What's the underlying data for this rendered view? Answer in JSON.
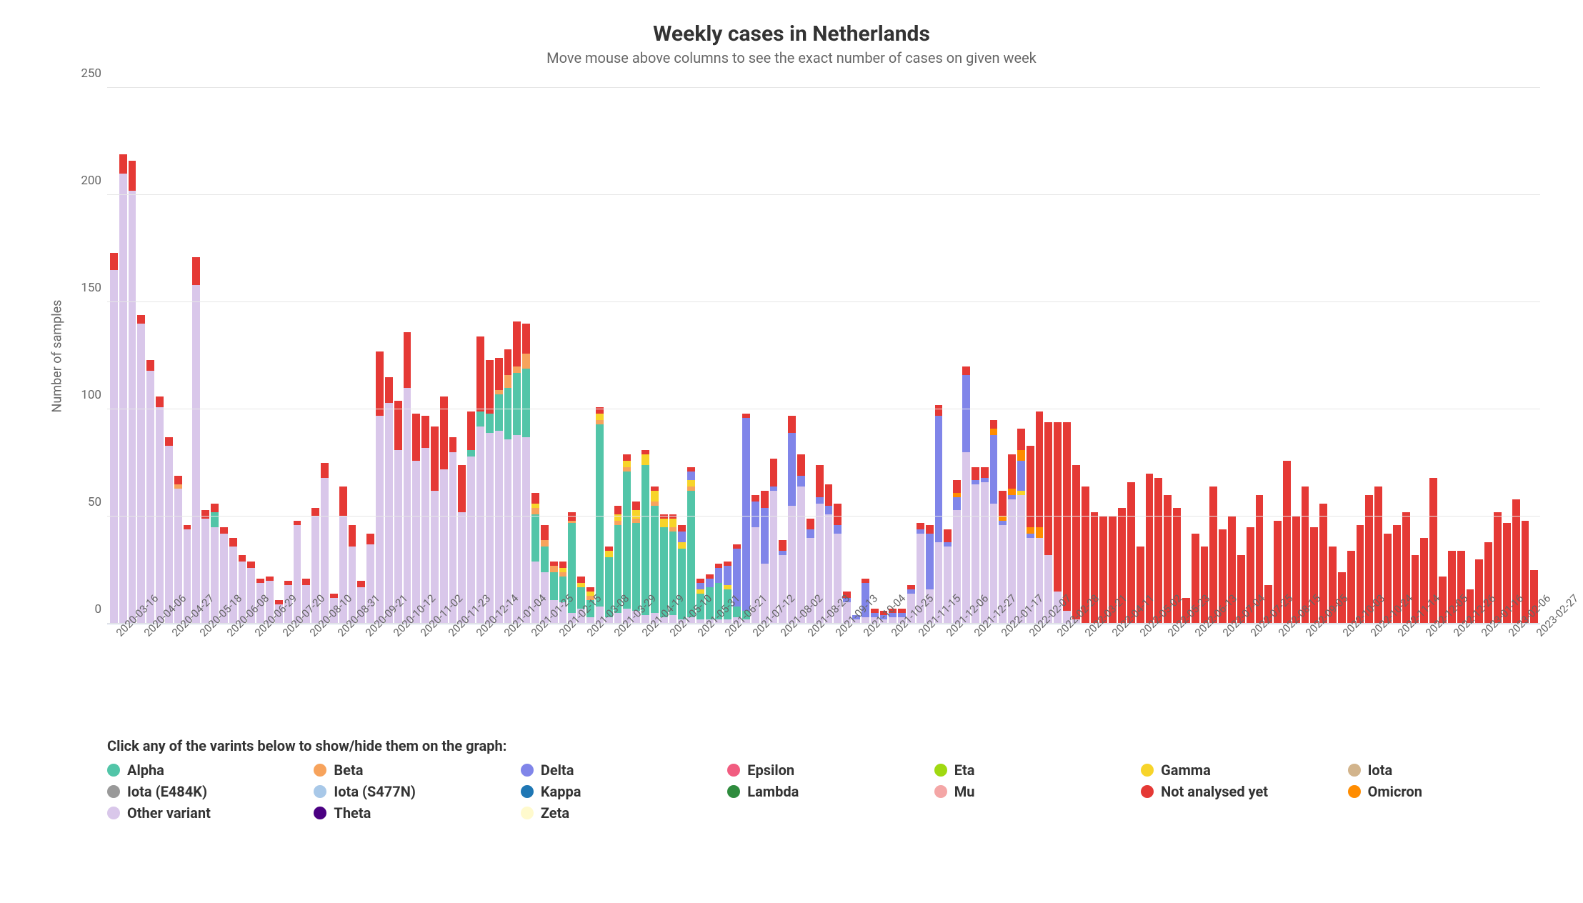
{
  "title": "Weekly cases in Netherlands",
  "subtitle": "Move mouse above columns to see the exact number of cases on given week",
  "ylabel": "Number of samples",
  "legend_title": "Click any of the varints below to show/hide them on the graph:",
  "series": [
    {
      "key": "alpha",
      "name": "Alpha",
      "color": "#52c5a8"
    },
    {
      "key": "beta",
      "name": "Beta",
      "color": "#f7a35c"
    },
    {
      "key": "delta",
      "name": "Delta",
      "color": "#8085e9"
    },
    {
      "key": "epsilon",
      "name": "Epsilon",
      "color": "#f15c80"
    },
    {
      "key": "eta",
      "name": "Eta",
      "color": "#a0d911"
    },
    {
      "key": "gamma",
      "name": "Gamma",
      "color": "#f7d42a"
    },
    {
      "key": "iota",
      "name": "Iota",
      "color": "#d2b48c"
    },
    {
      "key": "iota_e484k",
      "name": "Iota (E484K)",
      "color": "#999999"
    },
    {
      "key": "iota_s477n",
      "name": "Iota (S477N)",
      "color": "#a8c8e8"
    },
    {
      "key": "kappa",
      "name": "Kappa",
      "color": "#1f77b4"
    },
    {
      "key": "lambda",
      "name": "Lambda",
      "color": "#2e8b3d"
    },
    {
      "key": "mu",
      "name": "Mu",
      "color": "#f4a6a6"
    },
    {
      "key": "not_analysed",
      "name": "Not analysed yet",
      "color": "#e53935"
    },
    {
      "key": "omicron",
      "name": "Omicron",
      "color": "#ff8c00"
    },
    {
      "key": "other",
      "name": "Other variant",
      "color": "#d9c7ea"
    },
    {
      "key": "theta",
      "name": "Theta",
      "color": "#4b0082"
    },
    {
      "key": "zeta",
      "name": "Zeta",
      "color": "#fffacd"
    }
  ],
  "chart_data": {
    "type": "bar",
    "title": "Weekly cases in Netherlands",
    "xlabel": "",
    "ylabel": "Number of samples",
    "ylim": [
      0,
      250
    ],
    "yticks": [
      0,
      50,
      100,
      150,
      200,
      250
    ],
    "categories": [
      "2020-03-16",
      "2020-03-23",
      "2020-03-30",
      "2020-04-06",
      "2020-04-13",
      "2020-04-20",
      "2020-04-27",
      "2020-05-04",
      "2020-05-11",
      "2020-05-18",
      "2020-05-25",
      "2020-06-01",
      "2020-06-08",
      "2020-06-15",
      "2020-06-22",
      "2020-06-29",
      "2020-07-06",
      "2020-07-13",
      "2020-07-20",
      "2020-07-27",
      "2020-08-03",
      "2020-08-10",
      "2020-08-17",
      "2020-08-24",
      "2020-08-31",
      "2020-09-07",
      "2020-09-14",
      "2020-09-21",
      "2020-09-28",
      "2020-10-05",
      "2020-10-12",
      "2020-10-19",
      "2020-10-26",
      "2020-11-02",
      "2020-11-09",
      "2020-11-16",
      "2020-11-23",
      "2020-11-30",
      "2020-12-07",
      "2020-12-14",
      "2020-12-21",
      "2020-12-28",
      "2021-01-04",
      "2021-01-11",
      "2021-01-18",
      "2021-01-25",
      "2021-02-01",
      "2021-02-08",
      "2021-02-15",
      "2021-02-22",
      "2021-03-01",
      "2021-03-08",
      "2021-03-15",
      "2021-03-22",
      "2021-03-29",
      "2021-04-05",
      "2021-04-12",
      "2021-04-19",
      "2021-04-26",
      "2021-05-03",
      "2021-05-10",
      "2021-05-17",
      "2021-05-24",
      "2021-05-31",
      "2021-06-07",
      "2021-06-14",
      "2021-06-21",
      "2021-06-28",
      "2021-07-05",
      "2021-07-12",
      "2021-07-19",
      "2021-07-26",
      "2021-08-02",
      "2021-08-09",
      "2021-08-16",
      "2021-08-23",
      "2021-08-30",
      "2021-09-06",
      "2021-09-13",
      "2021-09-20",
      "2021-09-27",
      "2021-10-04",
      "2021-10-11",
      "2021-10-18",
      "2021-10-25",
      "2021-11-01",
      "2021-11-08",
      "2021-11-15",
      "2021-11-22",
      "2021-11-29",
      "2021-12-06",
      "2021-12-13",
      "2021-12-20",
      "2021-12-27",
      "2022-01-03",
      "2022-01-10",
      "2022-01-17",
      "2022-01-24",
      "2022-01-31",
      "2022-02-07",
      "2022-02-14",
      "2022-02-21",
      "2022-02-28",
      "2022-03-07",
      "2022-03-14",
      "2022-03-21",
      "2022-03-28",
      "2022-04-04",
      "2022-04-11",
      "2022-04-18",
      "2022-04-25",
      "2022-05-02",
      "2022-05-09",
      "2022-05-16",
      "2022-05-23",
      "2022-05-30",
      "2022-06-06",
      "2022-06-13",
      "2022-06-20",
      "2022-06-27",
      "2022-07-04",
      "2022-07-11",
      "2022-07-18",
      "2022-07-25",
      "2022-08-01",
      "2022-08-08",
      "2022-08-15",
      "2022-08-22",
      "2022-08-29",
      "2022-09-05",
      "2022-09-12",
      "2022-09-19",
      "2022-09-26",
      "2022-10-03",
      "2022-10-10",
      "2022-10-17",
      "2022-10-24",
      "2022-10-31",
      "2022-11-07",
      "2022-11-14",
      "2022-11-21",
      "2022-11-28",
      "2022-12-05",
      "2022-12-12",
      "2022-12-19",
      "2022-12-26",
      "2023-01-02",
      "2023-01-09",
      "2023-01-16",
      "2023-01-23",
      "2023-01-30",
      "2023-02-06",
      "2023-02-13",
      "2023-02-20",
      "2023-02-27"
    ],
    "xticks_visible": [
      "2020-03-16",
      "2020-04-06",
      "2020-04-27",
      "2020-05-18",
      "2020-06-08",
      "2020-06-29",
      "2020-07-20",
      "2020-08-10",
      "2020-08-31",
      "2020-09-21",
      "2020-10-12",
      "2020-11-02",
      "2020-11-23",
      "2020-12-14",
      "2021-01-04",
      "2021-01-25",
      "2021-02-15",
      "2021-03-08",
      "2021-03-29",
      "2021-04-19",
      "2021-05-10",
      "2021-05-31",
      "2021-06-21",
      "2021-07-12",
      "2021-08-02",
      "2021-08-23",
      "2021-09-13",
      "2021-10-04",
      "2021-10-25",
      "2021-11-15",
      "2021-12-06",
      "2021-12-27",
      "2022-01-17",
      "2022-02-07",
      "2022-02-28",
      "2022-03-21",
      "2022-04-11",
      "2022-05-02",
      "2022-05-23",
      "2022-06-13",
      "2022-07-04",
      "2022-07-25",
      "2022-08-15",
      "2022-09-05",
      "2022-10-03",
      "2022-10-24",
      "2022-11-14",
      "2022-12-05",
      "2022-12-26",
      "2023-01-16",
      "2023-02-06",
      "2023-02-27"
    ],
    "stacks": [
      {
        "other": 165,
        "not_analysed": 8
      },
      {
        "other": 210,
        "not_analysed": 9
      },
      {
        "other": 202,
        "not_analysed": 14
      },
      {
        "other": 140,
        "not_analysed": 4
      },
      {
        "other": 118,
        "not_analysed": 5
      },
      {
        "other": 101,
        "not_analysed": 5
      },
      {
        "other": 83,
        "not_analysed": 4
      },
      {
        "other": 63,
        "not_analysed": 4,
        "beta": 2
      },
      {
        "other": 44,
        "not_analysed": 2
      },
      {
        "other": 158,
        "not_analysed": 13
      },
      {
        "other": 49,
        "not_analysed": 4
      },
      {
        "other": 45,
        "not_analysed": 4,
        "alpha": 7
      },
      {
        "other": 42,
        "not_analysed": 3
      },
      {
        "other": 36,
        "not_analysed": 4
      },
      {
        "other": 29,
        "not_analysed": 3
      },
      {
        "other": 26,
        "not_analysed": 3
      },
      {
        "other": 19,
        "not_analysed": 2
      },
      {
        "other": 20,
        "not_analysed": 2
      },
      {
        "other": 9,
        "not_analysed": 2
      },
      {
        "other": 18,
        "not_analysed": 2
      },
      {
        "other": 46,
        "not_analysed": 2
      },
      {
        "other": 18,
        "not_analysed": 3
      },
      {
        "other": 50,
        "not_analysed": 4
      },
      {
        "other": 68,
        "not_analysed": 7
      },
      {
        "other": 12,
        "not_analysed": 2
      },
      {
        "other": 50,
        "not_analysed": 14
      },
      {
        "other": 36,
        "not_analysed": 10
      },
      {
        "other": 17,
        "not_analysed": 3
      },
      {
        "other": 37,
        "not_analysed": 5
      },
      {
        "other": 97,
        "not_analysed": 30
      },
      {
        "other": 103,
        "not_analysed": 12
      },
      {
        "other": 81,
        "not_analysed": 23
      },
      {
        "other": 110,
        "not_analysed": 26
      },
      {
        "other": 76,
        "not_analysed": 22
      },
      {
        "other": 82,
        "not_analysed": 15
      },
      {
        "other": 62,
        "not_analysed": 30
      },
      {
        "other": 72,
        "not_analysed": 34
      },
      {
        "other": 80,
        "not_analysed": 7
      },
      {
        "other": 52,
        "not_analysed": 22
      },
      {
        "other": 78,
        "not_analysed": 18,
        "alpha": 3
      },
      {
        "other": 92,
        "not_analysed": 35,
        "alpha": 7
      },
      {
        "other": 89,
        "not_analysed": 25,
        "alpha": 9
      },
      {
        "other": 90,
        "not_analysed": 15,
        "alpha": 17,
        "beta": 2
      },
      {
        "other": 86,
        "not_analysed": 12,
        "alpha": 24,
        "beta": 6
      },
      {
        "other": 88,
        "not_analysed": 21,
        "alpha": 29,
        "beta": 3
      },
      {
        "other": 87,
        "not_analysed": 14,
        "alpha": 32,
        "beta": 7
      },
      {
        "other": 29,
        "not_analysed": 5,
        "alpha": 22,
        "beta": 3,
        "gamma": 2
      },
      {
        "other": 24,
        "not_analysed": 7,
        "alpha": 12,
        "beta": 3
      },
      {
        "other": 11,
        "not_analysed": 2,
        "alpha": 13,
        "beta": 3
      },
      {
        "other": 10,
        "not_analysed": 3,
        "alpha": 12,
        "beta": 2,
        "gamma": 2
      },
      {
        "other": 5,
        "not_analysed": 4,
        "alpha": 42,
        "beta": 1
      },
      {
        "other": 7,
        "not_analysed": 3,
        "alpha": 10,
        "gamma": 2
      },
      {
        "other": 3,
        "not_analysed": 2,
        "alpha": 8,
        "beta": 2,
        "gamma": 2
      },
      {
        "other": 8,
        "not_analysed": 3,
        "alpha": 85,
        "beta": 2,
        "gamma": 3
      },
      {
        "other": 3,
        "not_analysed": 2,
        "alpha": 28,
        "gamma": 3
      },
      {
        "other": 5,
        "not_analysed": 4,
        "alpha": 41,
        "beta": 2,
        "gamma": 3
      },
      {
        "other": 7,
        "not_analysed": 3,
        "alpha": 64,
        "beta": 2,
        "gamma": 3
      },
      {
        "other": 6,
        "not_analysed": 4,
        "alpha": 41,
        "beta": 2,
        "gamma": 4
      },
      {
        "other": 4,
        "not_analysed": 2,
        "alpha": 70,
        "gamma": 5
      },
      {
        "other": 5,
        "not_analysed": 2,
        "alpha": 50,
        "beta": 2,
        "gamma": 5
      },
      {
        "other": 3,
        "not_analysed": 2,
        "alpha": 42,
        "gamma": 4
      },
      {
        "other": 4,
        "not_analysed": 2,
        "alpha": 39,
        "beta": 2,
        "gamma": 4
      },
      {
        "other": 2,
        "not_analysed": 3,
        "alpha": 33,
        "gamma": 3,
        "delta": 5
      },
      {
        "other": 3,
        "not_analysed": 2,
        "alpha": 59,
        "beta": 2,
        "gamma": 3,
        "delta": 4
      },
      {
        "other": 2,
        "not_analysed": 2,
        "alpha": 12,
        "gamma": 2,
        "delta": 3
      },
      {
        "other": 2,
        "not_analysed": 2,
        "alpha": 15,
        "delta": 4
      },
      {
        "other": 2,
        "not_analysed": 2,
        "alpha": 17,
        "delta": 7
      },
      {
        "other": 2,
        "not_analysed": 2,
        "alpha": 14,
        "gamma": 2,
        "delta": 9
      },
      {
        "other": 3,
        "not_analysed": 2,
        "alpha": 5,
        "delta": 27
      },
      {
        "other": 2,
        "not_analysed": 2,
        "alpha": 4,
        "delta": 90
      },
      {
        "other": 45,
        "not_analysed": 3,
        "delta": 12
      },
      {
        "other": 28,
        "not_analysed": 8,
        "delta": 26
      },
      {
        "other": 62,
        "not_analysed": 13,
        "delta": 2
      },
      {
        "other": 32,
        "not_analysed": 5,
        "delta": 2
      },
      {
        "other": 55,
        "not_analysed": 8,
        "delta": 34
      },
      {
        "other": 64,
        "not_analysed": 10,
        "delta": 5
      },
      {
        "other": 40,
        "not_analysed": 5,
        "delta": 4
      },
      {
        "other": 56,
        "not_analysed": 15,
        "delta": 3
      },
      {
        "other": 51,
        "not_analysed": 10,
        "delta": 4
      },
      {
        "other": 42,
        "not_analysed": 10,
        "delta": 4
      },
      {
        "other": 10,
        "not_analysed": 3,
        "delta": 2
      },
      {
        "other": 2,
        "delta": 2
      },
      {
        "other": 3,
        "not_analysed": 2,
        "delta": 16
      },
      {
        "other": 3,
        "not_analysed": 2,
        "delta": 2
      },
      {
        "other": 2,
        "not_analysed": 2,
        "delta": 2
      },
      {
        "other": 3,
        "not_analysed": 2,
        "delta": 2
      },
      {
        "other": 3,
        "not_analysed": 2,
        "delta": 2
      },
      {
        "other": 14,
        "not_analysed": 2,
        "delta": 2
      },
      {
        "other": 42,
        "not_analysed": 3,
        "delta": 2
      },
      {
        "other": 16,
        "not_analysed": 4,
        "delta": 26
      },
      {
        "other": 38,
        "not_analysed": 5,
        "delta": 59
      },
      {
        "other": 36,
        "not_analysed": 6,
        "delta": 2
      },
      {
        "other": 53,
        "not_analysed": 6,
        "delta": 6,
        "omicron": 2
      },
      {
        "other": 80,
        "not_analysed": 4,
        "delta": 36
      },
      {
        "other": 65,
        "not_analysed": 6,
        "delta": 2
      },
      {
        "other": 66,
        "not_analysed": 5,
        "delta": 2
      },
      {
        "other": 56,
        "not_analysed": 4,
        "omicron": 3,
        "delta": 32
      },
      {
        "other": 46,
        "not_analysed": 12,
        "omicron": 2,
        "delta": 2
      },
      {
        "other": 58,
        "not_analysed": 16,
        "omicron": 3,
        "delta": 2
      },
      {
        "other": 60,
        "not_analysed": 10,
        "omicron": 5,
        "gamma": 2,
        "delta": 14
      },
      {
        "other": 40,
        "not_analysed": 38,
        "omicron": 3,
        "delta": 2
      },
      {
        "other": 40,
        "not_analysed": 54,
        "omicron": 5
      },
      {
        "other": 32,
        "not_analysed": 62
      },
      {
        "other": 15,
        "not_analysed": 79
      },
      {
        "other": 6,
        "not_analysed": 88
      },
      {
        "other": 2,
        "not_analysed": 72
      },
      {
        "not_analysed": 64
      },
      {
        "not_analysed": 52
      },
      {
        "not_analysed": 50
      },
      {
        "not_analysed": 50
      },
      {
        "not_analysed": 54
      },
      {
        "not_analysed": 66
      },
      {
        "not_analysed": 36
      },
      {
        "not_analysed": 70
      },
      {
        "not_analysed": 68
      },
      {
        "not_analysed": 60
      },
      {
        "not_analysed": 54
      },
      {
        "not_analysed": 12
      },
      {
        "not_analysed": 42
      },
      {
        "not_analysed": 36
      },
      {
        "not_analysed": 64
      },
      {
        "not_analysed": 44
      },
      {
        "not_analysed": 50
      },
      {
        "not_analysed": 32
      },
      {
        "not_analysed": 45
      },
      {
        "not_analysed": 60
      },
      {
        "not_analysed": 18
      },
      {
        "not_analysed": 48
      },
      {
        "not_analysed": 76
      },
      {
        "not_analysed": 50
      },
      {
        "not_analysed": 64
      },
      {
        "not_analysed": 45
      },
      {
        "not_analysed": 56
      },
      {
        "not_analysed": 36
      },
      {
        "not_analysed": 24
      },
      {
        "not_analysed": 34
      },
      {
        "not_analysed": 46
      },
      {
        "not_analysed": 60
      },
      {
        "not_analysed": 64
      },
      {
        "not_analysed": 42
      },
      {
        "not_analysed": 46
      },
      {
        "not_analysed": 52
      },
      {
        "not_analysed": 32
      },
      {
        "not_analysed": 40
      },
      {
        "not_analysed": 68
      },
      {
        "not_analysed": 22
      },
      {
        "not_analysed": 34
      },
      {
        "not_analysed": 34
      },
      {
        "not_analysed": 16
      },
      {
        "not_analysed": 30
      },
      {
        "not_analysed": 38
      },
      {
        "not_analysed": 52
      },
      {
        "not_analysed": 47
      },
      {
        "not_analysed": 58
      },
      {
        "not_analysed": 48
      },
      {
        "not_analysed": 25
      }
    ]
  }
}
